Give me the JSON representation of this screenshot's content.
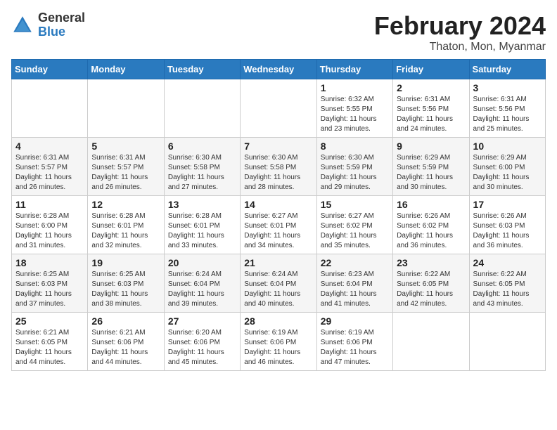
{
  "logo": {
    "general": "General",
    "blue": "Blue"
  },
  "header": {
    "month": "February 2024",
    "location": "Thaton, Mon, Myanmar"
  },
  "weekdays": [
    "Sunday",
    "Monday",
    "Tuesday",
    "Wednesday",
    "Thursday",
    "Friday",
    "Saturday"
  ],
  "weeks": [
    [
      {
        "day": "",
        "info": ""
      },
      {
        "day": "",
        "info": ""
      },
      {
        "day": "",
        "info": ""
      },
      {
        "day": "",
        "info": ""
      },
      {
        "day": "1",
        "info": "Sunrise: 6:32 AM\nSunset: 5:55 PM\nDaylight: 11 hours and 23 minutes."
      },
      {
        "day": "2",
        "info": "Sunrise: 6:31 AM\nSunset: 5:56 PM\nDaylight: 11 hours and 24 minutes."
      },
      {
        "day": "3",
        "info": "Sunrise: 6:31 AM\nSunset: 5:56 PM\nDaylight: 11 hours and 25 minutes."
      }
    ],
    [
      {
        "day": "4",
        "info": "Sunrise: 6:31 AM\nSunset: 5:57 PM\nDaylight: 11 hours and 26 minutes."
      },
      {
        "day": "5",
        "info": "Sunrise: 6:31 AM\nSunset: 5:57 PM\nDaylight: 11 hours and 26 minutes."
      },
      {
        "day": "6",
        "info": "Sunrise: 6:30 AM\nSunset: 5:58 PM\nDaylight: 11 hours and 27 minutes."
      },
      {
        "day": "7",
        "info": "Sunrise: 6:30 AM\nSunset: 5:58 PM\nDaylight: 11 hours and 28 minutes."
      },
      {
        "day": "8",
        "info": "Sunrise: 6:30 AM\nSunset: 5:59 PM\nDaylight: 11 hours and 29 minutes."
      },
      {
        "day": "9",
        "info": "Sunrise: 6:29 AM\nSunset: 5:59 PM\nDaylight: 11 hours and 30 minutes."
      },
      {
        "day": "10",
        "info": "Sunrise: 6:29 AM\nSunset: 6:00 PM\nDaylight: 11 hours and 30 minutes."
      }
    ],
    [
      {
        "day": "11",
        "info": "Sunrise: 6:28 AM\nSunset: 6:00 PM\nDaylight: 11 hours and 31 minutes."
      },
      {
        "day": "12",
        "info": "Sunrise: 6:28 AM\nSunset: 6:01 PM\nDaylight: 11 hours and 32 minutes."
      },
      {
        "day": "13",
        "info": "Sunrise: 6:28 AM\nSunset: 6:01 PM\nDaylight: 11 hours and 33 minutes."
      },
      {
        "day": "14",
        "info": "Sunrise: 6:27 AM\nSunset: 6:01 PM\nDaylight: 11 hours and 34 minutes."
      },
      {
        "day": "15",
        "info": "Sunrise: 6:27 AM\nSunset: 6:02 PM\nDaylight: 11 hours and 35 minutes."
      },
      {
        "day": "16",
        "info": "Sunrise: 6:26 AM\nSunset: 6:02 PM\nDaylight: 11 hours and 36 minutes."
      },
      {
        "day": "17",
        "info": "Sunrise: 6:26 AM\nSunset: 6:03 PM\nDaylight: 11 hours and 36 minutes."
      }
    ],
    [
      {
        "day": "18",
        "info": "Sunrise: 6:25 AM\nSunset: 6:03 PM\nDaylight: 11 hours and 37 minutes."
      },
      {
        "day": "19",
        "info": "Sunrise: 6:25 AM\nSunset: 6:03 PM\nDaylight: 11 hours and 38 minutes."
      },
      {
        "day": "20",
        "info": "Sunrise: 6:24 AM\nSunset: 6:04 PM\nDaylight: 11 hours and 39 minutes."
      },
      {
        "day": "21",
        "info": "Sunrise: 6:24 AM\nSunset: 6:04 PM\nDaylight: 11 hours and 40 minutes."
      },
      {
        "day": "22",
        "info": "Sunrise: 6:23 AM\nSunset: 6:04 PM\nDaylight: 11 hours and 41 minutes."
      },
      {
        "day": "23",
        "info": "Sunrise: 6:22 AM\nSunset: 6:05 PM\nDaylight: 11 hours and 42 minutes."
      },
      {
        "day": "24",
        "info": "Sunrise: 6:22 AM\nSunset: 6:05 PM\nDaylight: 11 hours and 43 minutes."
      }
    ],
    [
      {
        "day": "25",
        "info": "Sunrise: 6:21 AM\nSunset: 6:05 PM\nDaylight: 11 hours and 44 minutes."
      },
      {
        "day": "26",
        "info": "Sunrise: 6:21 AM\nSunset: 6:06 PM\nDaylight: 11 hours and 44 minutes."
      },
      {
        "day": "27",
        "info": "Sunrise: 6:20 AM\nSunset: 6:06 PM\nDaylight: 11 hours and 45 minutes."
      },
      {
        "day": "28",
        "info": "Sunrise: 6:19 AM\nSunset: 6:06 PM\nDaylight: 11 hours and 46 minutes."
      },
      {
        "day": "29",
        "info": "Sunrise: 6:19 AM\nSunset: 6:06 PM\nDaylight: 11 hours and 47 minutes."
      },
      {
        "day": "",
        "info": ""
      },
      {
        "day": "",
        "info": ""
      }
    ]
  ]
}
